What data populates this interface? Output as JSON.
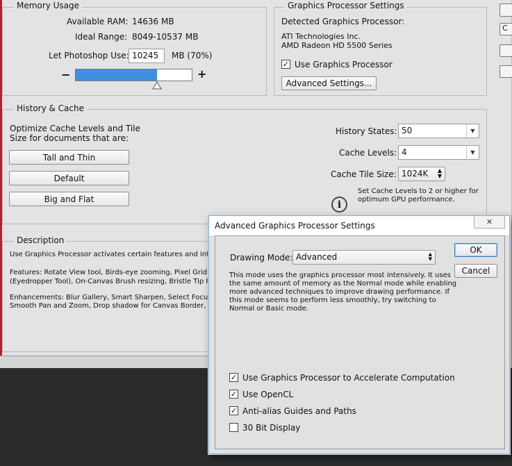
{
  "memory": {
    "legend": "Memory Usage",
    "available_label": "Available RAM:",
    "available_value": "14636 MB",
    "ideal_label": "Ideal Range:",
    "ideal_value": "8049-10537 MB",
    "let_use_label": "Let Photoshop Use:",
    "let_use_value": "10245",
    "let_use_suffix": "MB (70%)",
    "minus": "−",
    "plus": "+",
    "slider_fraction": 0.7
  },
  "gpu": {
    "legend": "Graphics Processor Settings",
    "detected_label": "Detected Graphics Processor:",
    "vendor": "ATI Technologies Inc.",
    "model": "AMD Radeon HD 5500 Series",
    "use_gpu_label": "Use Graphics Processor",
    "use_gpu_checked": true,
    "advanced_button": "Advanced Settings..."
  },
  "history": {
    "legend": "History & Cache",
    "optimize_text_line1": "Optimize Cache Levels and Tile",
    "optimize_text_line2": "Size for documents that are:",
    "btn_tall": "Tall and Thin",
    "btn_default": "Default",
    "btn_big": "Big and Flat",
    "states_label": "History States:",
    "states_value": "50",
    "levels_label": "Cache Levels:",
    "levels_value": "4",
    "tile_label": "Cache Tile Size:",
    "tile_value": "1024K",
    "hint_line1": "Set Cache Levels to 2 or higher for",
    "hint_line2": "optimum GPU performance.",
    "info_glyph": "i"
  },
  "description": {
    "legend": "Description",
    "line1": "Use Graphics Processor activates certain features and interface (",
    "line2": "Features: Rotate View tool, Birds-eye zooming, Pixel Grid, Flick P",
    "line3": "(Eyedropper Tool), On-Canvas Brush resizing, Bristle Tip Previe",
    "line4": "Enhancements: Blur Gallery, Smart Sharpen, Select Focus Area,",
    "line5": "Smooth Pan and Zoom, Drop shadow for Canvas Border, Painting"
  },
  "right_edge_buttons": {
    "b1": "C"
  },
  "dialog": {
    "title": "Advanced Graphics Processor Settings",
    "close_glyph": "✕",
    "drawing_mode_label": "Drawing Mode:",
    "drawing_mode_value": "Advanced",
    "mode_desc_1": "This mode uses the graphics processor most intensively.  It uses",
    "mode_desc_2": "the same amount of memory as the Normal mode while enabling",
    "mode_desc_3": "more advanced techniques to improve drawing performance.  If",
    "mode_desc_4": "this mode seems to perform less smoothly, try switching to",
    "mode_desc_5": "Normal or Basic mode.",
    "ok": "OK",
    "cancel": "Cancel",
    "options": [
      {
        "label": "Use Graphics Processor to Accelerate Computation",
        "checked": true
      },
      {
        "label": "Use OpenCL",
        "checked": true
      },
      {
        "label": "Anti-alias Guides and Paths",
        "checked": true
      },
      {
        "label": "30 Bit Display",
        "checked": false
      }
    ],
    "check_glyph": "✓"
  },
  "colors": {
    "slider_fill": "#3f8fe0",
    "dialog_border": "#8aa8c9"
  }
}
